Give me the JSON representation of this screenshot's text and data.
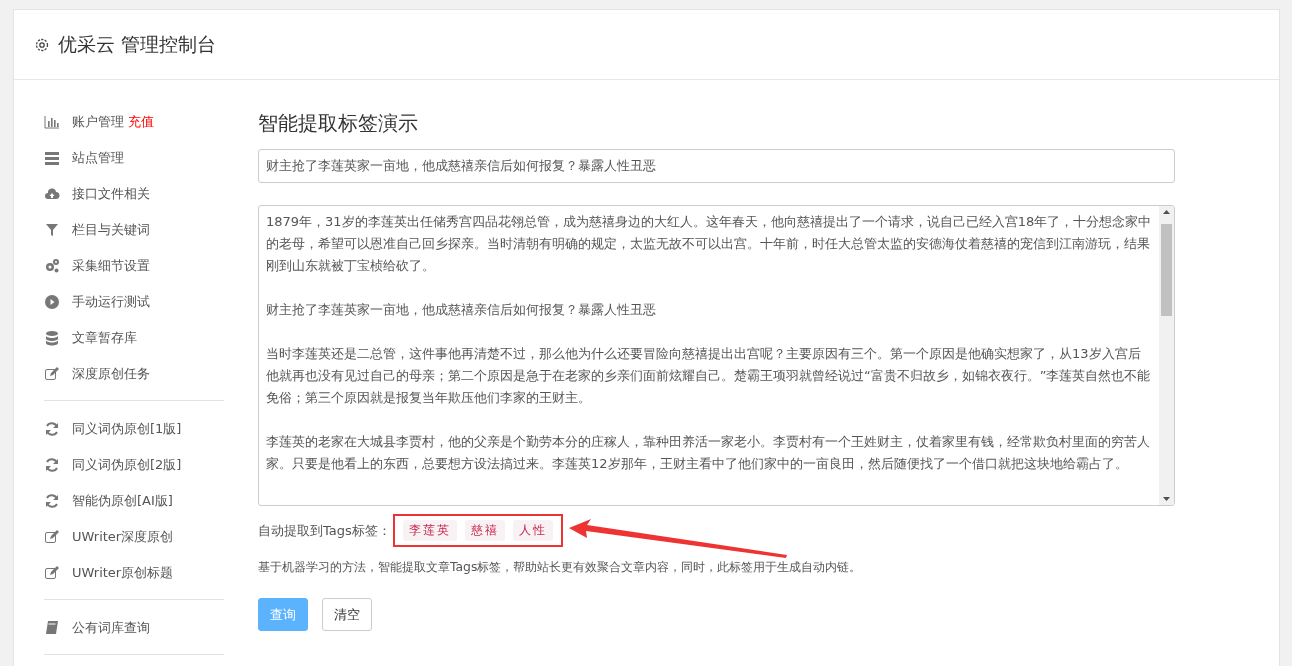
{
  "header": {
    "title": "优采云 管理控制台"
  },
  "sidebar": {
    "groups": [
      {
        "items": [
          {
            "label": "账户管理",
            "badge": "充值"
          },
          {
            "label": "站点管理"
          },
          {
            "label": "接口文件相关"
          },
          {
            "label": "栏目与关键词"
          },
          {
            "label": "采集细节设置"
          },
          {
            "label": "手动运行测试"
          },
          {
            "label": "文章暂存库"
          },
          {
            "label": "深度原创任务"
          }
        ]
      },
      {
        "items": [
          {
            "label": "同义词伪原创[1版]"
          },
          {
            "label": "同义词伪原创[2版]"
          },
          {
            "label": "智能伪原创[AI版]"
          },
          {
            "label": "UWriter深度原创"
          },
          {
            "label": "UWriter原创标题"
          }
        ]
      },
      {
        "items": [
          {
            "label": "公有词库查询"
          }
        ]
      }
    ]
  },
  "main": {
    "title": "智能提取标签演示",
    "title_field": {
      "value": "财主抢了李莲英家一亩地，他成慈禧亲信后如何报复？暴露人性丑恶"
    },
    "content_field": {
      "paragraphs": [
        "1879年，31岁的李莲英出任储秀宫四品花翎总管，成为慈禧身边的大红人。这年春天，他向慈禧提出了一个请求，说自己已经入宫18年了，十分想念家中的老母，希望可以恩准自己回乡探亲。当时清朝有明确的规定，太监无故不可以出宫。十年前，时任大总管太监的安德海仗着慈禧的宠信到江南游玩，结果刚到山东就被丁宝桢给砍了。",
        "财主抢了李莲英家一亩地，他成慈禧亲信后如何报复？暴露人性丑恶",
        "当时李莲英还是二总管，这件事他再清楚不过，那么他为什么还要冒险向慈禧提出出宫呢？主要原因有三个。第一个原因是他确实想家了，从13岁入宫后他就再也没有见过自己的母亲；第二个原因是急于在老家的乡亲们面前炫耀自己。楚霸王项羽就曾经说过“富贵不归故乡，如锦衣夜行。”李莲英自然也不能免俗；第三个原因就是报复当年欺压他们李家的王财主。",
        "李莲英的老家在大城县李贾村，他的父亲是个勤劳本分的庄稼人，靠种田养活一家老小。李贾村有一个王姓财主，仗着家里有钱，经常欺负村里面的穷苦人家。只要是他看上的东西，总要想方设法搞过来。李莲英12岁那年，王财主看中了他们家中的一亩良田，然后随便找了一个借口就把这块地给霸占了。"
      ]
    },
    "tags_label": "自动提取到Tags标签：",
    "tags": [
      "李莲英",
      "慈禧",
      "人性"
    ],
    "description": "基于机器学习的方法，智能提取文章Tags标签，帮助站长更有效聚合文章内容，同时，此标签用于生成自动内链。",
    "buttons": [
      {
        "label": "查询",
        "kind": "primary"
      },
      {
        "label": "清空",
        "kind": "default"
      }
    ]
  }
}
